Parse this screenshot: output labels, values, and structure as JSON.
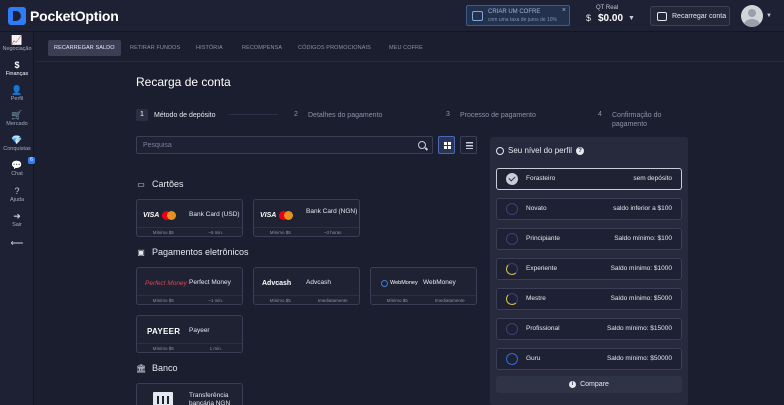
{
  "header": {
    "brand": "PocketOption",
    "promo": {
      "line1": "CRIAR UM COFRE",
      "line2": "com uma taxa de juros de 10%",
      "close": "×"
    },
    "balance": {
      "label": "QT Real",
      "value": "$0.00",
      "currency_icon": "$",
      "caret": "▼"
    },
    "recharge_label": "Recarregar conta",
    "avatar_caret": "▼"
  },
  "sidebar": {
    "items": [
      {
        "label": "Negociação",
        "icon": "chart-icon",
        "glyph": "📈"
      },
      {
        "label": "Finanças",
        "icon": "dollar-icon",
        "glyph": "$"
      },
      {
        "label": "Perfil",
        "icon": "person-icon",
        "glyph": "👤"
      },
      {
        "label": "Mercado",
        "icon": "cart-icon",
        "glyph": "🛒"
      },
      {
        "label": "Conquistas",
        "icon": "diamond-icon",
        "glyph": "💎"
      },
      {
        "label": "Chat",
        "icon": "chat-icon",
        "glyph": "💬",
        "badge": "6"
      },
      {
        "label": "Ajuda",
        "icon": "help-icon",
        "glyph": "?"
      },
      {
        "label": "Sair",
        "icon": "logout-icon",
        "glyph": "➜"
      },
      {
        "label": "",
        "icon": "collapse-icon",
        "glyph": "⟵"
      }
    ]
  },
  "tabs": [
    {
      "label": "RECARREGAR SALDO"
    },
    {
      "label": "RETIRAR FUNDOS"
    },
    {
      "label": "HISTÓRIA"
    },
    {
      "label": "RECOMPENSA"
    },
    {
      "label": "CÓDIGOS PROMOCIONAIS"
    },
    {
      "label": "MEU COFRE"
    }
  ],
  "main": {
    "title": "Recarga de conta",
    "steps": [
      {
        "num": "1",
        "label": "Método de depósito"
      },
      {
        "num": "2",
        "label": "Detalhes do pagamento"
      },
      {
        "num": "3",
        "label": "Processo de pagamento"
      },
      {
        "num": "4",
        "label": "Confirmação do pagamento"
      }
    ],
    "search_placeholder": "Pesquisa",
    "sections": {
      "cards": "Cartões",
      "ewallets": "Pagamentos eletrônicos",
      "bank": "Banco"
    },
    "methods": {
      "card_usd": {
        "logo": "VISA",
        "name": "Bank Card (USD)",
        "min": "Mínimo $5",
        "time": "~5 min."
      },
      "card_ngn": {
        "logo": "VISA",
        "name": "Bank Card (NGN)",
        "min": "Mínimo $5",
        "time": "~3 horas"
      },
      "perfect_money": {
        "logo": "Perfect Money",
        "name": "Perfect Money",
        "min": "Mínimo $5",
        "time": "~1 min."
      },
      "advcash": {
        "logo": "Advcash",
        "name": "Advcash",
        "min": "Mínimo $5",
        "time": "Imediatamente"
      },
      "webmoney": {
        "logo": "WebMoney",
        "name": "WebMoney",
        "min": "Mínimo $5",
        "time": "Imediatamente"
      },
      "payeer": {
        "logo": "PAYEER",
        "name": "Payeer",
        "min": "Mínimo $5",
        "time": "1 min."
      },
      "bank_ngn": {
        "name": "Transferência bancária NGN"
      }
    }
  },
  "profile_level": {
    "title": "Seu nível do perfil",
    "levels": [
      {
        "name": "Forasteiro",
        "req": "sem depósito"
      },
      {
        "name": "Novato",
        "req": "saldo inferior a $100"
      },
      {
        "name": "Principiante",
        "req": "Saldo mínimo: $100"
      },
      {
        "name": "Experiente",
        "req": "Saldo mínimo: $1000"
      },
      {
        "name": "Mestre",
        "req": "Saldo mínimo: $5000"
      },
      {
        "name": "Profissional",
        "req": "Saldo mínimo: $15000"
      },
      {
        "name": "Guru",
        "req": "Saldo mínimo: $50000"
      }
    ],
    "compare_label": "Compare"
  },
  "colors": {
    "accent": "#2f7cf6",
    "background": "#1b1e2e",
    "panel": "#262a3c"
  }
}
